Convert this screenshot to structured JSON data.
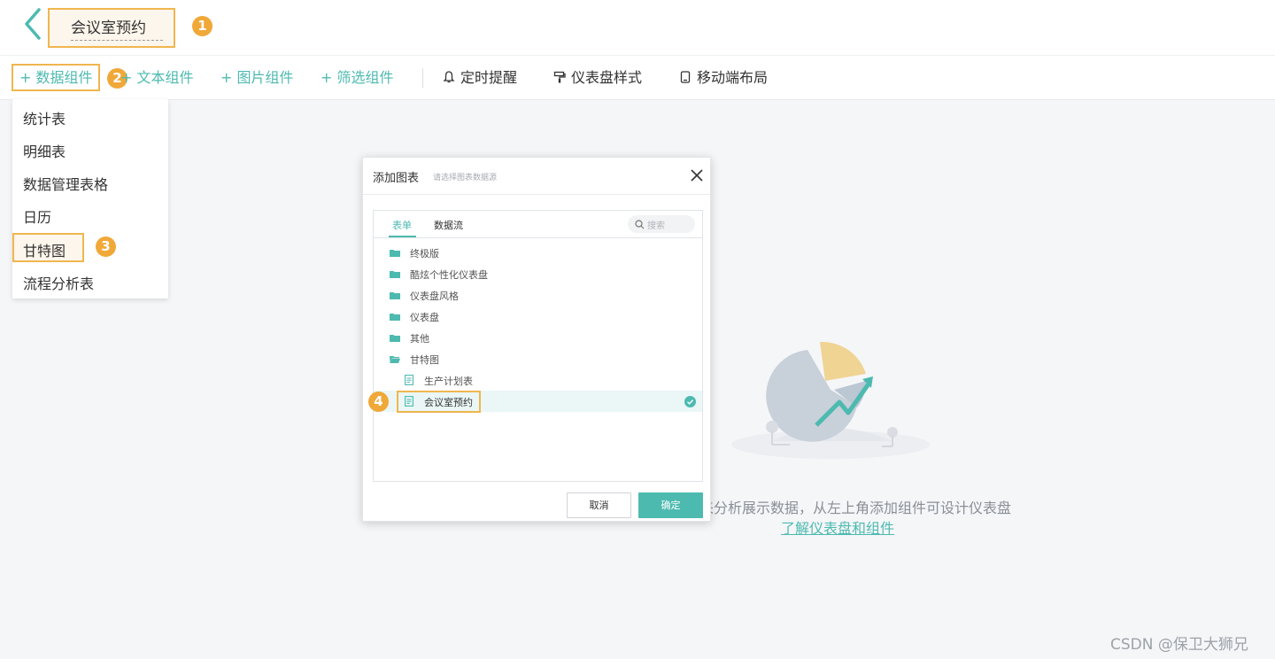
{
  "header": {
    "title": "会议室预约",
    "step_badges": [
      "1",
      "2",
      "3",
      "4"
    ]
  },
  "toolbar": {
    "data_component": "+ 数据组件",
    "text_component": "+ 文本组件",
    "image_component": "+ 图片组件",
    "filter_component": "+ 筛选组件",
    "timed_reminder": "定时提醒",
    "dashboard_style": "仪表盘样式",
    "mobile_layout": "移动端布局"
  },
  "dropdown": {
    "items": [
      "统计表",
      "明细表",
      "数据管理表格",
      "日历",
      "甘特图",
      "流程分析表"
    ]
  },
  "empty_state": {
    "text": "来分析展示数据，从左上角添加组件可设计仪表盘",
    "link": "了解仪表盘和组件"
  },
  "modal": {
    "title": "添加图表",
    "subtitle": "请选择图表数据源",
    "tabs": [
      "表单",
      "数据流"
    ],
    "search_placeholder": "搜索",
    "tree": [
      {
        "label": "终极版",
        "type": "folder"
      },
      {
        "label": "酷炫个性化仪表盘",
        "type": "folder"
      },
      {
        "label": "仪表盘风格",
        "type": "folder"
      },
      {
        "label": "仪表盘",
        "type": "folder"
      },
      {
        "label": "其他",
        "type": "folder"
      },
      {
        "label": "甘特图",
        "type": "folder-open"
      },
      {
        "label": "生产计划表",
        "type": "file"
      },
      {
        "label": "会议室预约",
        "type": "file",
        "selected": true
      }
    ],
    "cancel": "取消",
    "confirm": "确定"
  },
  "colors": {
    "accent": "#4dbab0",
    "highlight_border": "#f0b64f",
    "badge": "#f0a839"
  },
  "watermark": "CSDN @保卫大狮兄"
}
